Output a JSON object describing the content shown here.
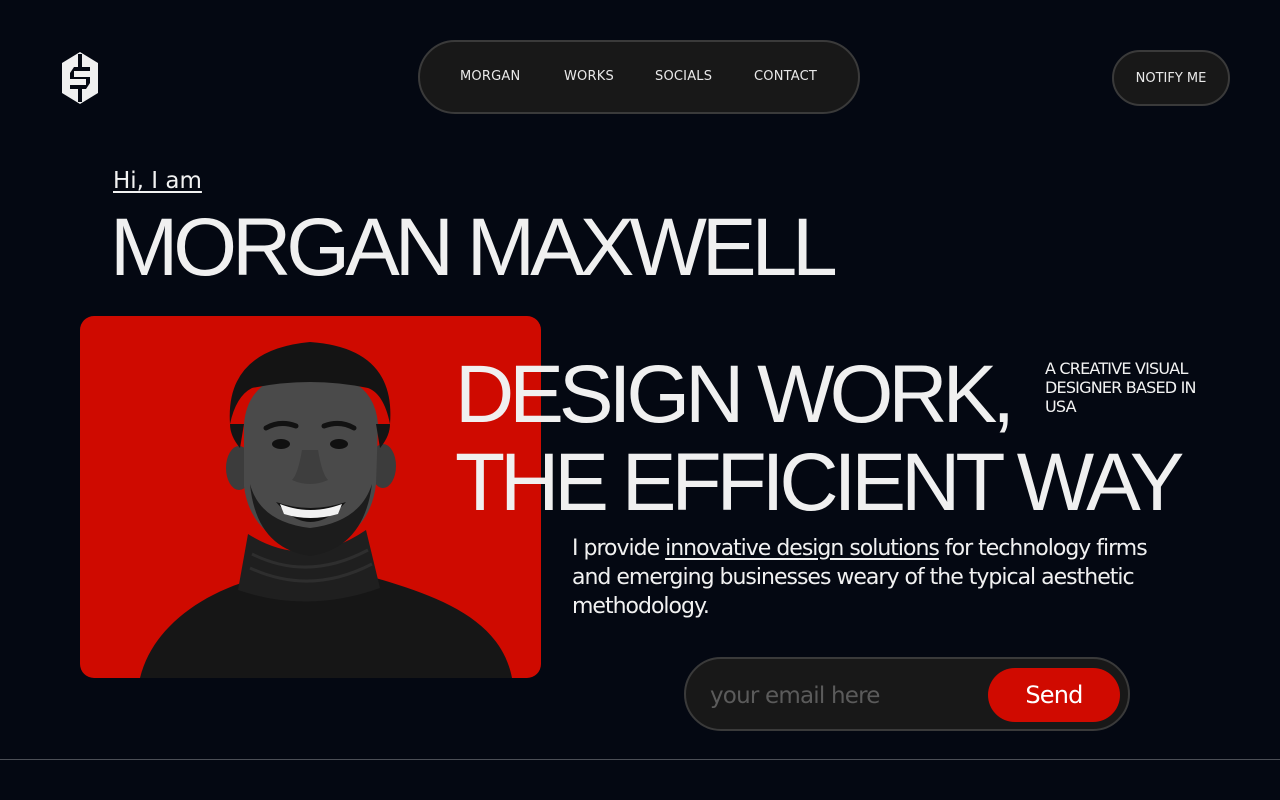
{
  "icons": {
    "logo": "hex-s-logo-icon"
  },
  "nav": {
    "items": [
      {
        "label": "MORGAN"
      },
      {
        "label": "WORKS"
      },
      {
        "label": "SOCIALS"
      },
      {
        "label": "CONTACT"
      }
    ],
    "notify_label": "NOTIFY ME"
  },
  "hero": {
    "greeting": "Hi, I am",
    "name": "MORGAN MAXWELL",
    "heading_line1": "DESIGN WORK,",
    "heading_line2": "THE EFFICIENT WAY",
    "tagline": "A CREATIVE VISUAL DESIGNER BASED IN USA",
    "description": {
      "before": "I provide ",
      "link": "innovative design solutions",
      "after": " for technology firms and emerging businesses weary of the typical aesthetic methodology."
    }
  },
  "subscribe": {
    "placeholder": "your email here",
    "value": "",
    "button_label": "Send"
  },
  "colors": {
    "background": "#040812",
    "accent_red": "#d00a00",
    "pill_bg": "#181818"
  }
}
